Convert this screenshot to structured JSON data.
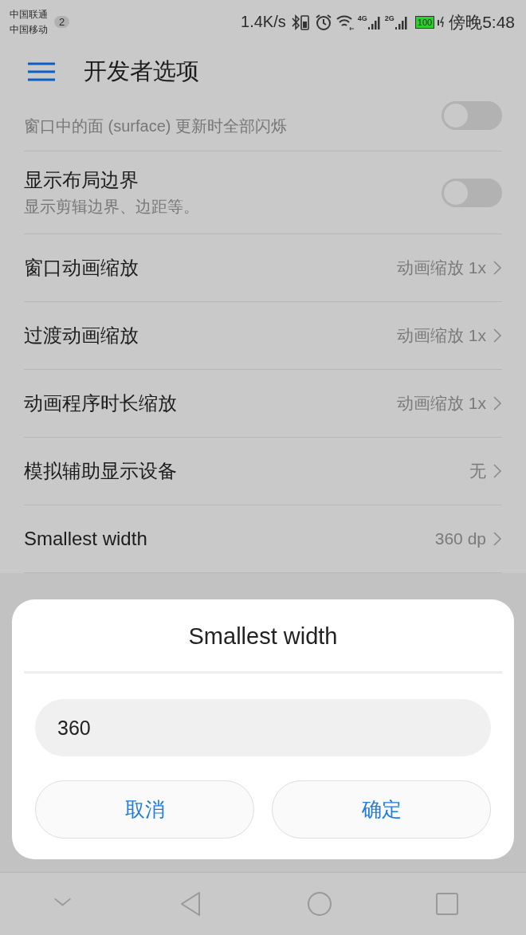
{
  "status_bar": {
    "carriers": [
      "中国联通",
      "中国移动"
    ],
    "sim_badge": "2",
    "speed": "1.4K/s",
    "networks": [
      "4G",
      "2G"
    ],
    "battery": "100",
    "time": "傍晚5:48"
  },
  "header": {
    "title": "开发者选项"
  },
  "settings": [
    {
      "kind": "toggle",
      "subtitle": "窗口中的面 (surface) 更新时全部闪烁",
      "on": false
    },
    {
      "kind": "toggle",
      "title": "显示布局边界",
      "subtitle": "显示剪辑边界、边距等。",
      "on": false
    },
    {
      "kind": "link",
      "title": "窗口动画缩放",
      "value": "动画缩放 1x"
    },
    {
      "kind": "link",
      "title": "过渡动画缩放",
      "value": "动画缩放 1x"
    },
    {
      "kind": "link",
      "title": "动画程序时长缩放",
      "value": "动画缩放 1x"
    },
    {
      "kind": "link",
      "title": "模拟辅助显示设备",
      "value": "无"
    },
    {
      "kind": "link",
      "title": "Smallest width",
      "value": "360 dp"
    }
  ],
  "dialog": {
    "title": "Smallest width",
    "value": "360",
    "buttons": [
      "取消",
      "确定"
    ]
  }
}
